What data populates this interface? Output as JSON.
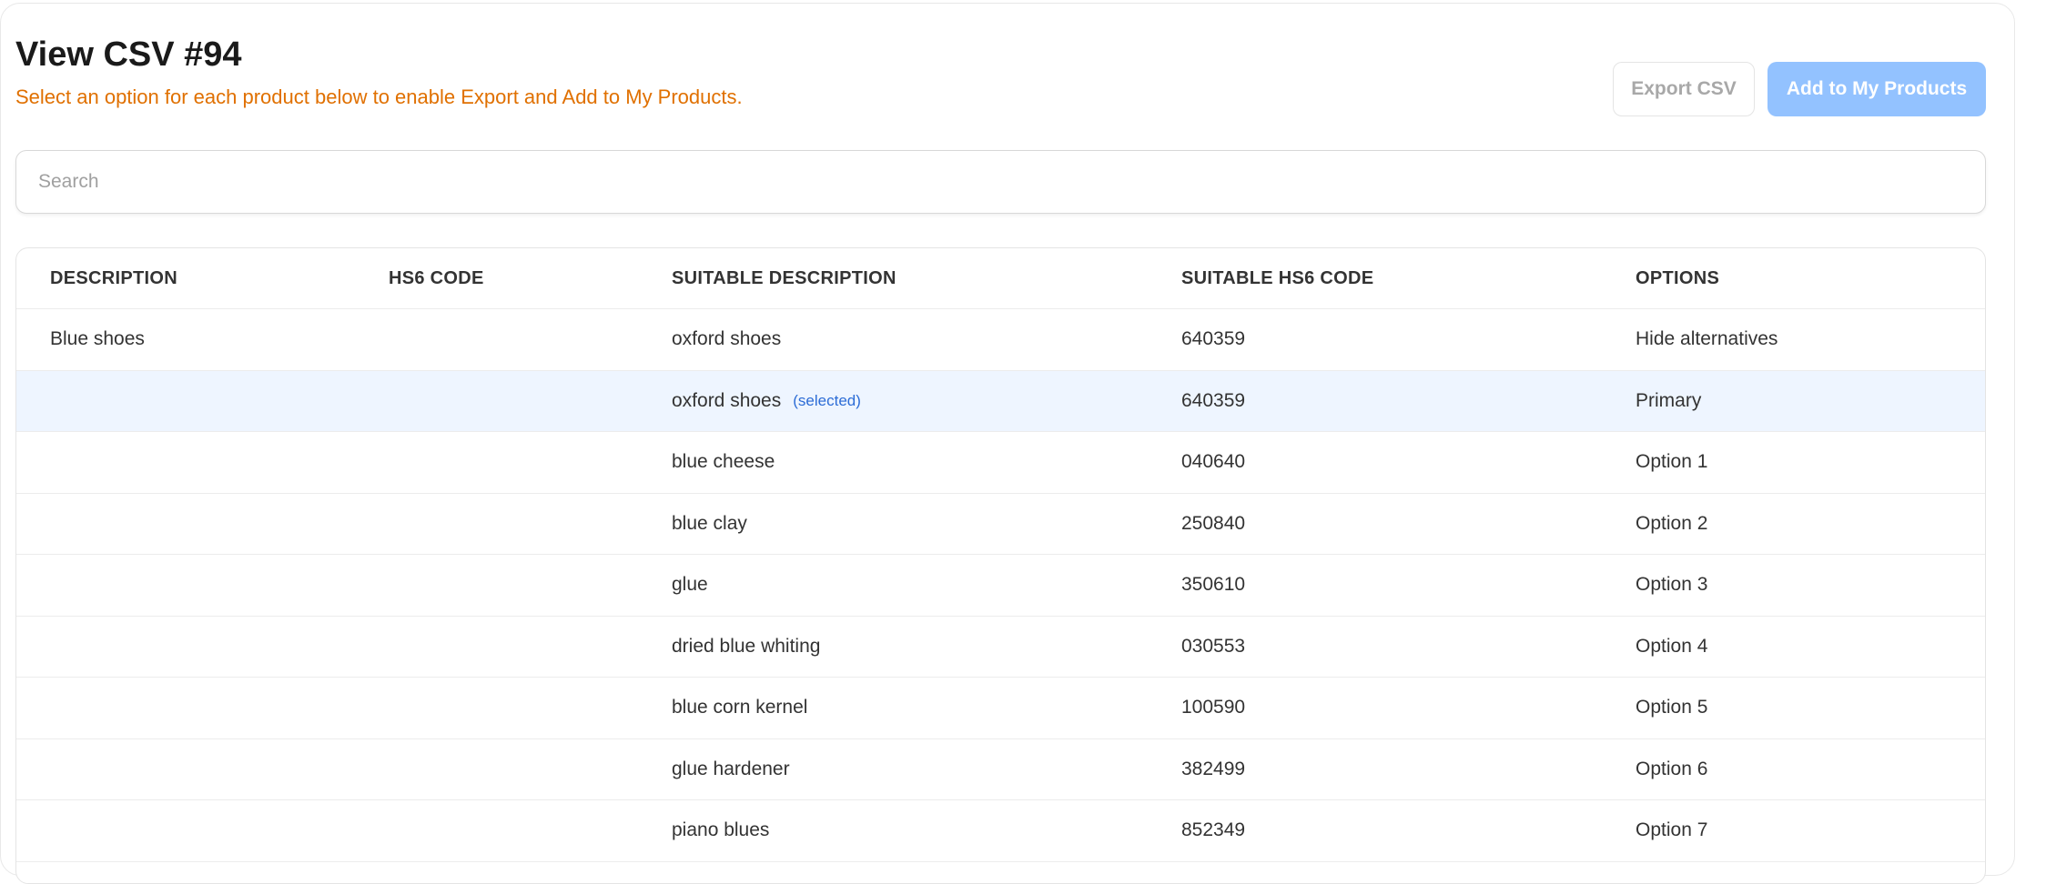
{
  "page": {
    "title": "View CSV #94",
    "subtitle": "Select an option for each product below to enable Export and Add to My Products."
  },
  "actions": {
    "export_label": "Export CSV",
    "add_label": "Add to My Products"
  },
  "search": {
    "placeholder": "Search",
    "value": ""
  },
  "table": {
    "columns": [
      "DESCRIPTION",
      "HS6 CODE",
      "SUITABLE DESCRIPTION",
      "SUITABLE HS6 CODE",
      "OPTIONS"
    ],
    "rows": [
      {
        "description": "Blue shoes",
        "hs6": "",
        "suitable_description": "oxford shoes",
        "selected_tag": "",
        "suitable_hs6": "640359",
        "option": "Hide alternatives"
      },
      {
        "description": "",
        "hs6": "",
        "suitable_description": "oxford shoes",
        "selected_tag": "(selected)",
        "suitable_hs6": "640359",
        "option": "Primary"
      },
      {
        "description": "",
        "hs6": "",
        "suitable_description": "blue cheese",
        "selected_tag": "",
        "suitable_hs6": "040640",
        "option": "Option 1"
      },
      {
        "description": "",
        "hs6": "",
        "suitable_description": "blue clay",
        "selected_tag": "",
        "suitable_hs6": "250840",
        "option": "Option 2"
      },
      {
        "description": "",
        "hs6": "",
        "suitable_description": "glue",
        "selected_tag": "",
        "suitable_hs6": "350610",
        "option": "Option 3"
      },
      {
        "description": "",
        "hs6": "",
        "suitable_description": "dried blue whiting",
        "selected_tag": "",
        "suitable_hs6": "030553",
        "option": "Option 4"
      },
      {
        "description": "",
        "hs6": "",
        "suitable_description": "blue corn kernel",
        "selected_tag": "",
        "suitable_hs6": "100590",
        "option": "Option 5"
      },
      {
        "description": "",
        "hs6": "",
        "suitable_description": "glue hardener",
        "selected_tag": "",
        "suitable_hs6": "382499",
        "option": "Option 6"
      },
      {
        "description": "",
        "hs6": "",
        "suitable_description": "piano blues",
        "selected_tag": "",
        "suitable_hs6": "852349",
        "option": "Option 7"
      }
    ]
  },
  "colors": {
    "accent": "#e07000",
    "primary_button_disabled": "#93c2ff",
    "selected_row": "#eef5ff",
    "selected_tag": "#2c6cd6"
  }
}
